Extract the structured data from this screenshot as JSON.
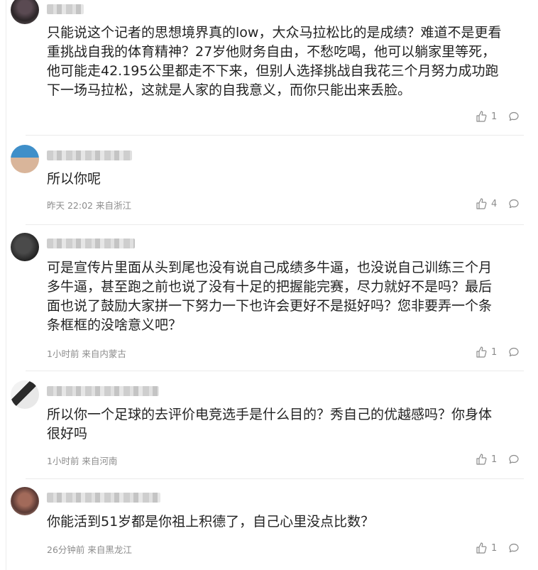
{
  "comments": [
    {
      "text": "只能说这个记者的思想境界真的low，大众马拉松比的是成绩？难道不是更看\n重挑战自我的体育精神？27岁他财务自由，不愁吃喝，他可以躺家里等死，\n他可能走42.195公里都走不下来，但别人选择挑战自我花三个月努力成功跑\n下一场马拉松，这就是人家的自我意义，而你只能出来丢脸。",
      "meta": "",
      "likes": "1"
    },
    {
      "text": "所以你呢",
      "meta": "昨天 22:02 来自浙江",
      "likes": "4"
    },
    {
      "text": "可是宣传片里面从头到尾也没有说自己成绩多牛逼，也没说自己训练三个月\n多牛逼，甚至跑之前也说了没有十足的把握能完赛，尽力就好不是吗？最后\n面也说了鼓励大家拼一下努力一下也许会更好不是挺好吗？您非要弄一个条\n条框框的没啥意义吧？",
      "meta": "1小时前 来自内蒙古",
      "likes": "1"
    },
    {
      "text": "所以你一个足球的去评价电竞选手是什么目的？秀自己的优越感吗？你身体\n很好吗",
      "meta": "1小时前 来自河南",
      "likes": "1"
    },
    {
      "text": "你能活到51岁都是你祖上积德了，自己心里没点比数？",
      "meta": "26分钟前 来自黑龙江",
      "likes": "1"
    }
  ],
  "icons": {
    "like": "thumbs-up-icon",
    "reply": "comment-bubble-icon"
  },
  "colors": {
    "text": "#222222",
    "meta": "#8c8c8c",
    "divider": "#ebebeb"
  }
}
